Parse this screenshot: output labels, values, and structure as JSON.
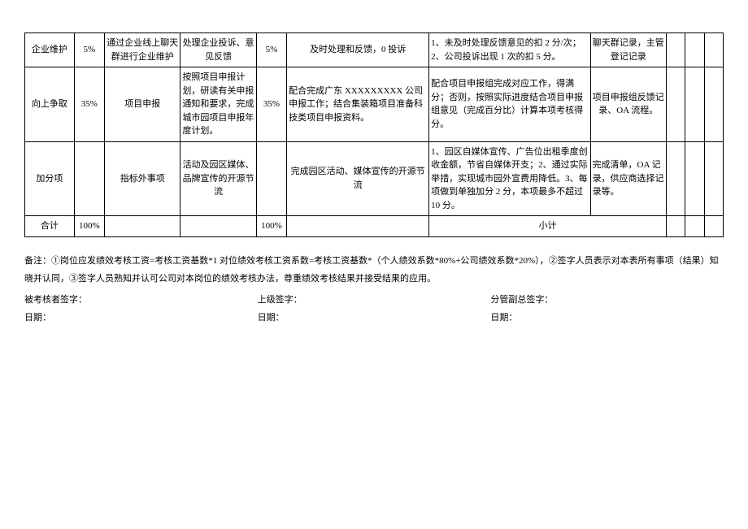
{
  "rows": [
    {
      "c1": "企业维护",
      "c2": "5%",
      "c3": "通过企业线上聊天群进行企业维护",
      "c4": "处理企业投诉、意见反馈",
      "c5": "5%",
      "c6": "及时处理和反馈，0 投诉",
      "c7": "1、未及时处理反馈意见的扣 2 分/次；2、公司投诉出现 1 次的扣 5 分。",
      "c8": "聊天群记录，主管登记记录"
    },
    {
      "c1": "向上争取",
      "c2": "35%",
      "c3": "项目申报",
      "c4": "按照项目申报计划，研读有关申报通知和要求，完成城市园项目申报年度计划。",
      "c5": "35%",
      "c6": "配合完成广东 XXXXXXXXX 公司申报工作；结合集装箱项目准备科技类项目申报资料。",
      "c7": "配合项目申报组完成对应工作，得满分；否则，按照实际进度结合项目申报组意见（完成百分比）计算本项考核得分。",
      "c8": "项目申报组反馈记录、OA 流程。"
    },
    {
      "c1": "加分项",
      "c2": "",
      "c3": "指标外事项",
      "c4": "活动及园区媒体、品牌宣传的开源节流",
      "c5": "",
      "c6": "完成园区活动、媒体宣传的开源节流",
      "c7": "1、园区自媒体宣传、广告位出租季度创收金额，节省自媒体开支；2、通过实际举措，实现城市园外宣费用降低。3、每项做到单独加分 2 分，本项最多不超过 10 分。",
      "c8": "完成清单，OA 记录，供应商选择记录等。"
    },
    {
      "c1": "合计",
      "c2": "100%",
      "c3": "",
      "c4": "",
      "c5": "100%",
      "c6": "",
      "c7_8": "小计"
    }
  ],
  "notes": "备注：①岗位应发绩效考核工资=考核工资基数*1 对位绩效考核工资系数=考核工资基数*（个人绩效系数*80%+公司绩效系数*20%），②签字人员表示对本表所有事项（结果）知晓并认同，③签字人员熟知并认可公司对本岗位的绩效考核办法，尊重绩效考核结果并接受结果的应用。",
  "sig": {
    "assessee": "被考核者签字：",
    "superior": "上级签字：",
    "deputy": "分管副总签字：",
    "date": "日期："
  }
}
